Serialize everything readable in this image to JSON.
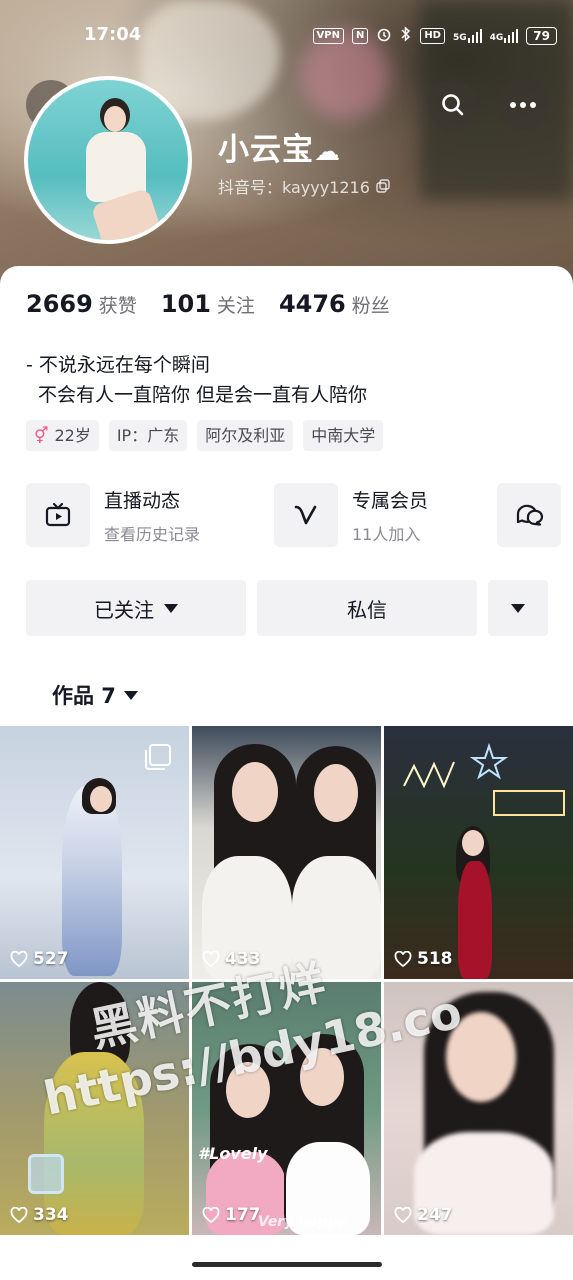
{
  "status_bar": {
    "time": "17:04",
    "vpn": "VPN",
    "nfc": "N",
    "hd": "HD",
    "network1": "5G",
    "network2": "4G",
    "battery": "79"
  },
  "profile": {
    "nickname": "小云宝",
    "douyin_id": "抖音号：kayyy1216",
    "stats": [
      {
        "num": "2669",
        "label": "获赞"
      },
      {
        "num": "101",
        "label": "关注"
      },
      {
        "num": "4476",
        "label": "粉丝"
      }
    ],
    "bio_lines": [
      "- 不说永远在每个瞬间",
      "不会有人一直陪你 但是会一直有人陪你"
    ],
    "tags": [
      "22岁",
      "IP：广东",
      "阿尔及利亚",
      "中南大学"
    ]
  },
  "features": {
    "live_title": "直播动态",
    "live_sub": "查看历史记录",
    "vip_title": "专属会员",
    "vip_sub": "11人加入"
  },
  "actions": {
    "followed": "已关注",
    "message": "私信"
  },
  "works_tab": "作品 7",
  "works": [
    {
      "likes": "527"
    },
    {
      "likes": "433"
    },
    {
      "likes": "518"
    },
    {
      "likes": "334"
    },
    {
      "likes": "177"
    },
    {
      "likes": "247"
    }
  ],
  "tile_text": {
    "lovely": "#Lovely",
    "very_happy": "Very happy"
  },
  "watermark": {
    "line1": "黑料不打烊",
    "line2": "https://bdy18.co"
  },
  "colors": {
    "female_icon": "#f2548c",
    "primary_text": "#161823",
    "secondary_text": "#8a8a92",
    "button_bg": "#f2f2f4"
  }
}
